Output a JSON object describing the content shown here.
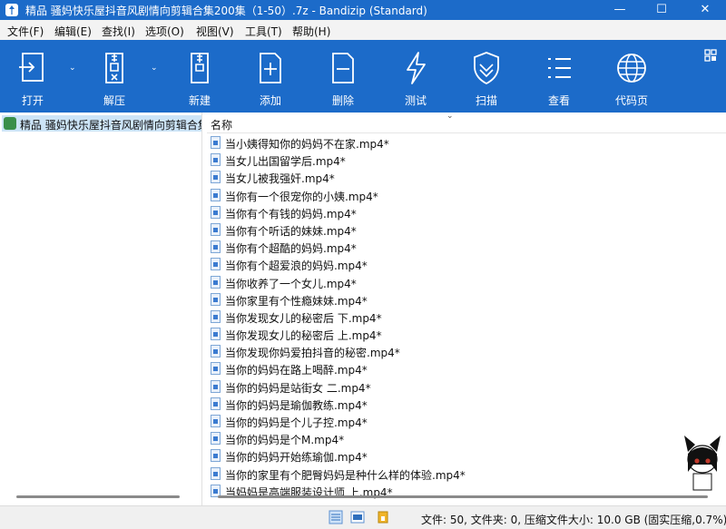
{
  "window": {
    "title": "精品 骚妈快乐屋抖音风剧情向剪辑合集200集（1-50）.7z - Bandizip (Standard)",
    "minimize": "—",
    "maximize": "☐",
    "close": "✕"
  },
  "menu": [
    "文件(F)",
    "编辑(E)",
    "查找(I)",
    "选项(O)",
    "视图(V)",
    "工具(T)",
    "帮助(H)"
  ],
  "toolbar": [
    {
      "label": "打开",
      "icon": "open-icon"
    },
    {
      "label": "解压",
      "icon": "extract-icon"
    },
    {
      "label": "新建",
      "icon": "new-archive-icon"
    },
    {
      "label": "添加",
      "icon": "add-file-icon"
    },
    {
      "label": "删除",
      "icon": "delete-file-icon"
    },
    {
      "label": "测试",
      "icon": "test-icon"
    },
    {
      "label": "扫描",
      "icon": "scan-shield-icon"
    },
    {
      "label": "查看",
      "icon": "view-list-icon"
    },
    {
      "label": "代码页",
      "icon": "codepage-globe-icon"
    }
  ],
  "tree": {
    "root_label": "精品 骚妈快乐屋抖音风剧情向剪辑合集"
  },
  "list": {
    "column_name": "名称",
    "files": [
      "当小姨得知你的妈妈不在家.mp4*",
      "当女儿出国留学后.mp4*",
      "当女儿被我强奸.mp4*",
      "当你有一个很宠你的小姨.mp4*",
      "当你有个有钱的妈妈.mp4*",
      "当你有个听话的妹妹.mp4*",
      "当你有个超酷的妈妈.mp4*",
      "当你有个超爱浪的妈妈.mp4*",
      "当你收养了一个女儿.mp4*",
      "当你家里有个性瘾妹妹.mp4*",
      "当你发现女儿的秘密后 下.mp4*",
      "当你发现女儿的秘密后 上.mp4*",
      "当你发现你妈爱拍抖音的秘密.mp4*",
      "当你的妈妈在路上喝醉.mp4*",
      "当你的妈妈是站街女 二.mp4*",
      "当你的妈妈是瑜伽教练.mp4*",
      "当你的妈妈是个儿子控.mp4*",
      "当你的妈妈是个M.mp4*",
      "当你的妈妈开始练瑜伽.mp4*",
      "当你的家里有个肥臀妈妈是种什么样的体验.mp4*",
      "当妈妈是高端服装设计师 上.mp4*"
    ]
  },
  "status": {
    "text": "文件: 50, 文件夹: 0, 压缩文件大小: 10.0 GB (固实压缩,0.7%)"
  },
  "colors": {
    "accent": "#1c6bc9",
    "selection": "#cce4f7"
  }
}
